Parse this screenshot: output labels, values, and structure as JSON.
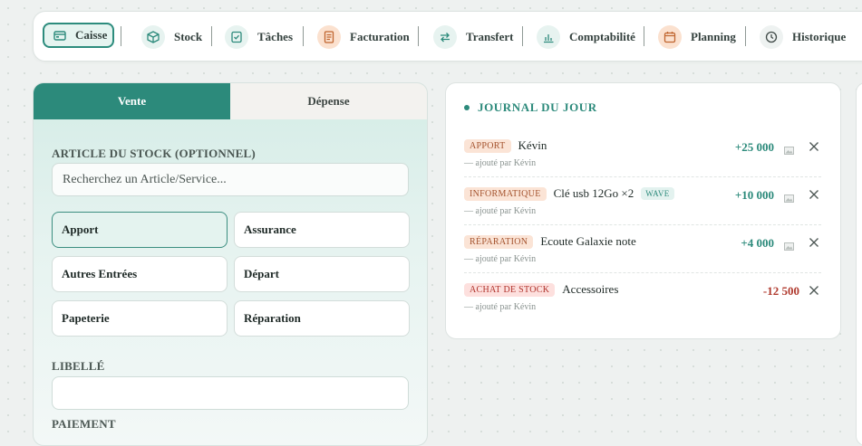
{
  "nav": {
    "items": [
      {
        "label": "Caisse",
        "icon": "cash-register-icon"
      },
      {
        "label": "Stock",
        "icon": "box-icon"
      },
      {
        "label": "Tâches",
        "icon": "checklist-icon"
      },
      {
        "label": "Facturation",
        "icon": "invoice-icon"
      },
      {
        "label": "Transfert",
        "icon": "transfer-arrows-icon"
      },
      {
        "label": "Comptabilité",
        "icon": "bar-chart-icon"
      },
      {
        "label": "Planning",
        "icon": "calendar-icon"
      },
      {
        "label": "Historique",
        "icon": "clock-icon"
      }
    ],
    "active": "Caisse"
  },
  "form": {
    "tabs": [
      {
        "label": "Vente"
      },
      {
        "label": "Dépense"
      }
    ],
    "active_tab": "Vente",
    "stock_label": "ARTICLE DU STOCK (OPTIONNEL)",
    "search_placeholder": "Recherchez un Article/Service...",
    "search_value": "",
    "categories": [
      {
        "label": "Apport"
      },
      {
        "label": "Assurance"
      },
      {
        "label": "Autres Entrées"
      },
      {
        "label": "Départ"
      },
      {
        "label": "Papeterie"
      },
      {
        "label": "Réparation"
      }
    ],
    "selected_category": "Apport",
    "libelle_label": "LIBELLÉ",
    "libelle_value": "",
    "payment_label": "PAIEMENT"
  },
  "journal": {
    "title": "JOURNAL DU JOUR",
    "entries": [
      {
        "category": "APPORT",
        "name": "Kévin",
        "tag": "",
        "amount": "+25 000",
        "added_by": "— ajouté par Kévin"
      },
      {
        "category": "INFORMATIQUE",
        "name": "Clé usb 12Go ×2",
        "tag": "WAVE",
        "amount": "+10 000",
        "added_by": "— ajouté par Kévin"
      },
      {
        "category": "RÉPARATION",
        "name": "Ecoute Galaxie note",
        "tag": "",
        "amount": "+4 000",
        "added_by": "— ajouté par Kévin"
      },
      {
        "category": "ACHAT DE STOCK",
        "name": "Accessoires",
        "tag": "",
        "amount": "-12 500",
        "added_by": "— ajouté par Kévin"
      }
    ]
  },
  "colors": {
    "accent": "#2c8a7b",
    "negative": "#b03a2e",
    "badge_warm": "#fbe4d6"
  }
}
